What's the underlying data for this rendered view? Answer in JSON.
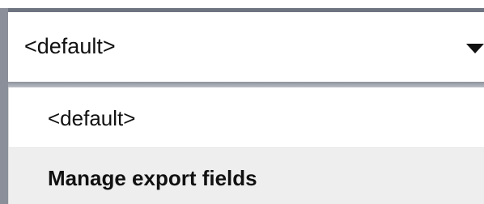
{
  "select": {
    "value": "<default>",
    "caret_icon": "triangle-down-icon"
  },
  "dropdown": {
    "options": [
      {
        "label": "<default>"
      },
      {
        "label": "Manage export fields"
      }
    ]
  },
  "colors": {
    "border": "#6e7480",
    "hover_bg": "#eeeeee",
    "text": "#111111"
  }
}
